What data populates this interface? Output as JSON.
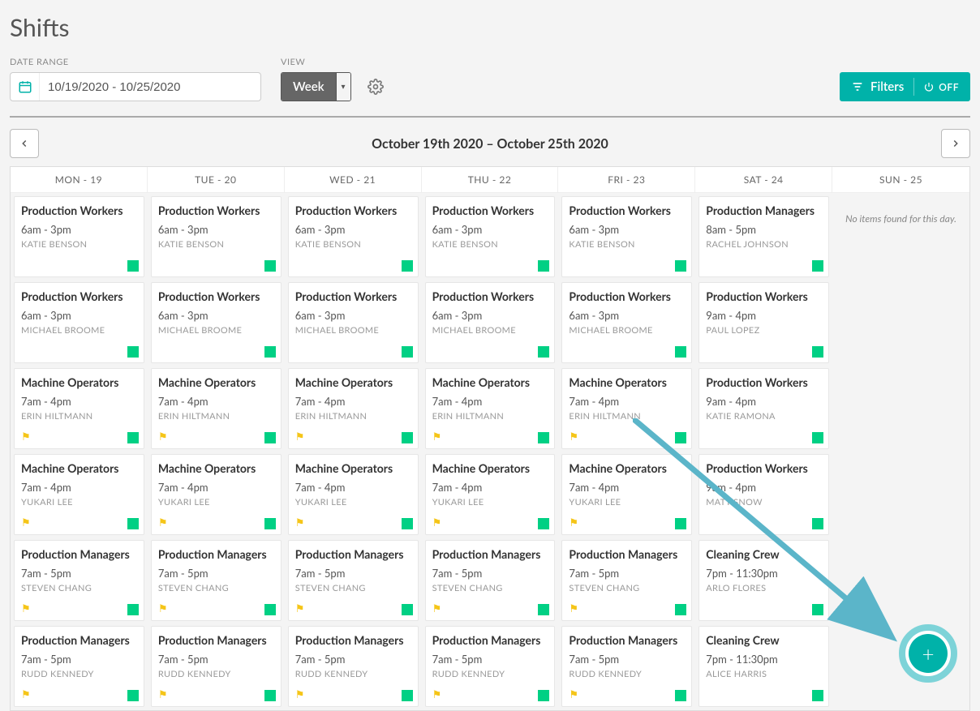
{
  "page_title": "Shifts",
  "labels": {
    "date_range": "DATE RANGE",
    "view": "VIEW"
  },
  "date_range_value": "10/19/2020 - 10/25/2020",
  "view_value": "Week",
  "filters": {
    "label": "Filters",
    "state": "OFF"
  },
  "week": {
    "title": "October 19th 2020 – October 25th 2020"
  },
  "empty_day_text": "No items found for this day.",
  "columns": [
    {
      "header": "MON - 19"
    },
    {
      "header": "TUE - 20"
    },
    {
      "header": "WED - 21"
    },
    {
      "header": "THU - 22"
    },
    {
      "header": "FRI - 23"
    },
    {
      "header": "SAT - 24"
    },
    {
      "header": "SUN - 25"
    }
  ],
  "shifts": {
    "weekday_common": [
      {
        "title": "Production Workers",
        "time": "6am - 3pm",
        "person": "KATIE BENSON",
        "flag": false
      },
      {
        "title": "Production Workers",
        "time": "6am - 3pm",
        "person": "MICHAEL BROOME",
        "flag": false
      },
      {
        "title": "Machine Operators",
        "time": "7am - 4pm",
        "person": "ERIN HILTMANN",
        "flag": true
      },
      {
        "title": "Machine Operators",
        "time": "7am - 4pm",
        "person": "YUKARI LEE",
        "flag": true
      },
      {
        "title": "Production Managers",
        "time": "7am - 5pm",
        "person": "STEVEN CHANG",
        "flag": true
      },
      {
        "title": "Production Managers",
        "time": "7am - 5pm",
        "person": "RUDD KENNEDY",
        "flag": true
      }
    ],
    "sat": [
      {
        "title": "Production Managers",
        "time": "8am - 5pm",
        "person": "RACHEL JOHNSON",
        "flag": false
      },
      {
        "title": "Production Workers",
        "time": "9am - 4pm",
        "person": "PAUL LOPEZ",
        "flag": false
      },
      {
        "title": "Production Workers",
        "time": "9am - 4pm",
        "person": "KATIE RAMONA",
        "flag": false
      },
      {
        "title": "Production Workers",
        "time": "9am - 4pm",
        "person": "MATT SNOW",
        "flag": false
      },
      {
        "title": "Cleaning Crew",
        "time": "7pm - 11:30pm",
        "person": "ARLO FLORES",
        "flag": false
      },
      {
        "title": "Cleaning Crew",
        "time": "7pm - 11:30pm",
        "person": "ALICE HARRIS",
        "flag": false
      }
    ]
  }
}
